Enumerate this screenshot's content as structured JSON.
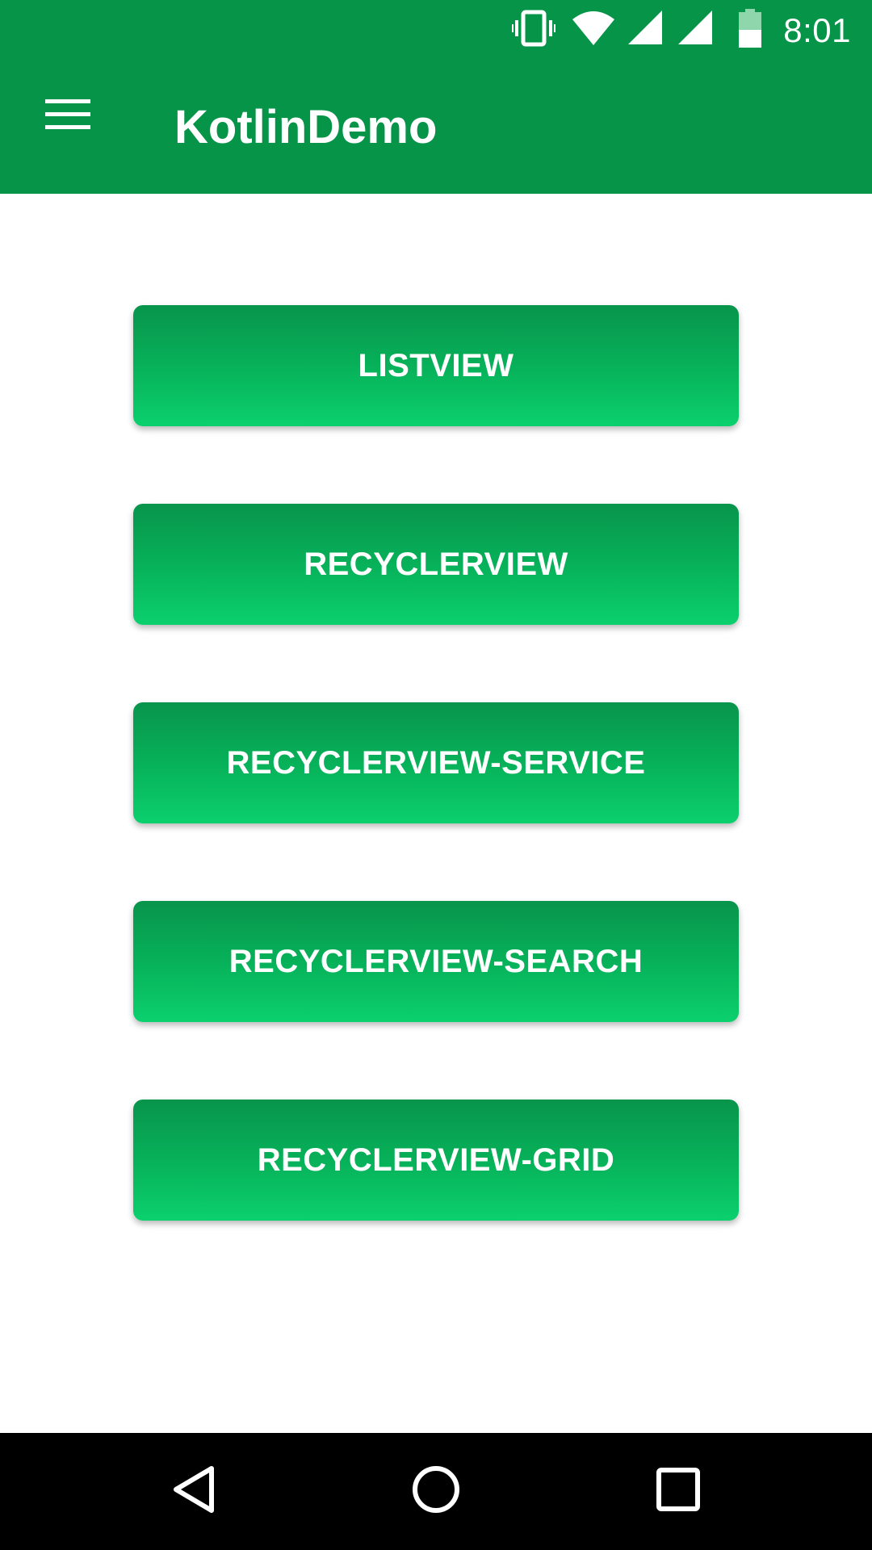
{
  "status_bar": {
    "time": "8:01",
    "icons": [
      "vibrate-icon",
      "wifi-icon",
      "signal-icon",
      "signal-icon",
      "battery-icon"
    ],
    "background": "#069449"
  },
  "app_bar": {
    "title": "KotlinDemo",
    "menu_icon": "hamburger-menu-icon",
    "background": "#069449"
  },
  "buttons": [
    {
      "label": "LISTVIEW"
    },
    {
      "label": "RECYCLERVIEW"
    },
    {
      "label": "RECYCLERVIEW-SERVICE"
    },
    {
      "label": "RECYCLERVIEW-SEARCH"
    },
    {
      "label": "RECYCLERVIEW-GRID"
    }
  ],
  "button_colors": {
    "top": "#08944c",
    "bottom": "#0bd06e",
    "text": "#ffffff"
  },
  "nav_bar": {
    "icons": [
      "back-icon",
      "home-icon",
      "recents-icon"
    ],
    "background": "#000000"
  }
}
